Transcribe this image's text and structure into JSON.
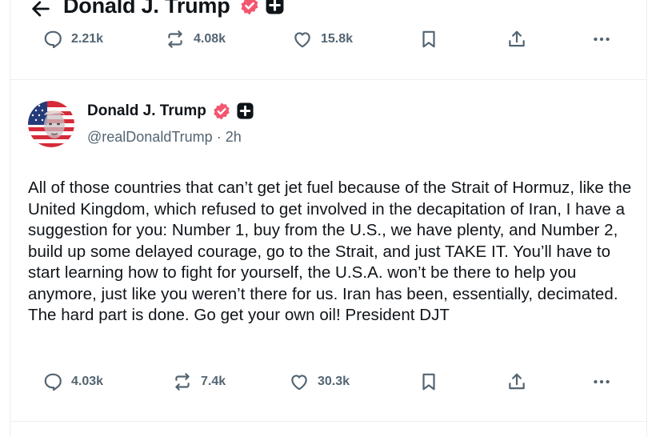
{
  "header": {
    "title": "Donald J. Trump"
  },
  "top_actions": {
    "replies": "2.21k",
    "reposts": "4.08k",
    "likes": "15.8k"
  },
  "post": {
    "display_name": "Donald J. Trump",
    "handle": "@realDonaldTrump",
    "separator": "·",
    "time": "2h",
    "text": "All of those countries that can’t get jet fuel because of the Strait of Hormuz, like the United Kingdom, which refused to get involved in the decapitation of Iran, I have a suggestion for you: Number 1, buy from the U.S., we have plenty, and Number 2, build up some delayed courage, go to the Strait, and just TAKE IT. You’ll have to start learning how to fight for yourself, the U.S.A. won’t be there to help you anymore, just like you weren’t there for us. Iran has been, essentially, decimated. The hard part is done. Go get your own oil! President DJT",
    "replies": "4.03k",
    "reposts": "7.4k",
    "likes": "30.3k"
  },
  "icons": {
    "back": "arrow-left-icon",
    "verified": "verified-badge-icon",
    "plus": "plus-badge-icon",
    "reply": "reply-icon",
    "repost": "repost-icon",
    "like": "heart-icon",
    "bookmark": "bookmark-icon",
    "share": "share-icon",
    "more": "more-icon"
  },
  "colors": {
    "verified": "#f2576f",
    "text": "#0f1419",
    "muted": "#536471",
    "border": "#eceef0"
  }
}
